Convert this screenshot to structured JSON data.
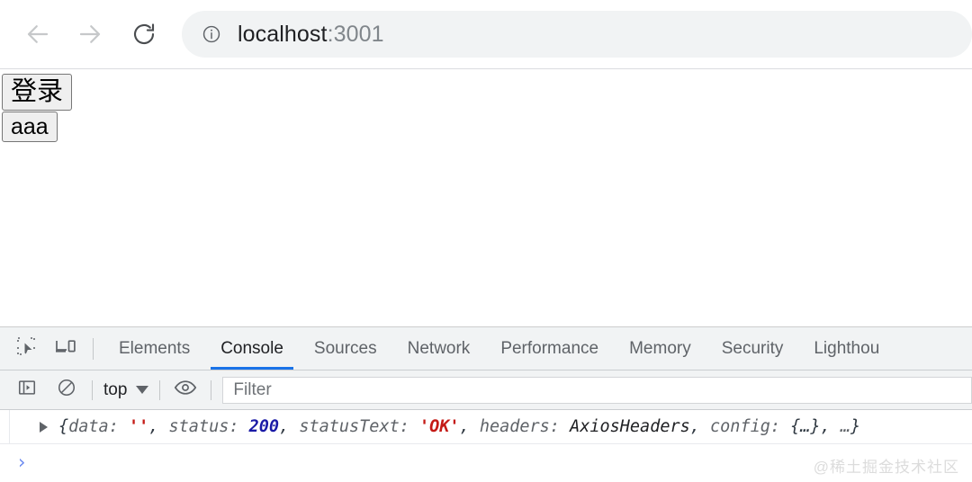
{
  "browser": {
    "back_icon": "arrow-left-icon",
    "forward_icon": "arrow-right-icon",
    "reload_icon": "reload-icon",
    "security_icon": "info-circle-icon",
    "url_host": "localhost",
    "url_port": ":3001",
    "url_full": "localhost:3001"
  },
  "page": {
    "buttons": [
      {
        "label": "登录",
        "name": "login-button"
      },
      {
        "label": "aaa",
        "name": "aaa-button"
      }
    ]
  },
  "devtools": {
    "inspect_icon": "inspect-element-icon",
    "device_icon": "device-toolbar-icon",
    "tabs": [
      {
        "label": "Elements",
        "active": false
      },
      {
        "label": "Console",
        "active": true
      },
      {
        "label": "Sources",
        "active": false
      },
      {
        "label": "Network",
        "active": false
      },
      {
        "label": "Performance",
        "active": false
      },
      {
        "label": "Memory",
        "active": false
      },
      {
        "label": "Security",
        "active": false
      },
      {
        "label": "Lighthou",
        "active": false
      }
    ],
    "active_tab": "Console",
    "accent_color": "#1a73e8",
    "toolbar": {
      "sidebar_icon": "console-sidebar-icon",
      "clear_icon": "clear-console-icon",
      "context_value": "top",
      "caret_icon": "chevron-down-icon",
      "eye_icon": "eye-icon",
      "filter_placeholder": "Filter"
    },
    "console": {
      "expand_icon": "expand-triangle-icon",
      "log": {
        "open_brace": "{",
        "key_data": "data: ",
        "val_data": "''",
        "sep1": ", ",
        "key_status": "status: ",
        "val_status": "200",
        "sep2": ", ",
        "key_statusText": "statusText: ",
        "val_statusText": "'OK'",
        "sep3": ", ",
        "key_headers": "headers: ",
        "val_headers": "AxiosHeaders",
        "sep4": ", ",
        "key_config": "config: ",
        "val_config": "{…}",
        "sep5": ", ",
        "ellipsis": "…",
        "close_brace": "}",
        "full_text": "{data: '', status: 200, statusText: 'OK', headers: AxiosHeaders, config: {…}, …}"
      },
      "prompt_chevron": "›"
    }
  },
  "watermark": "@稀土掘金技术社区"
}
